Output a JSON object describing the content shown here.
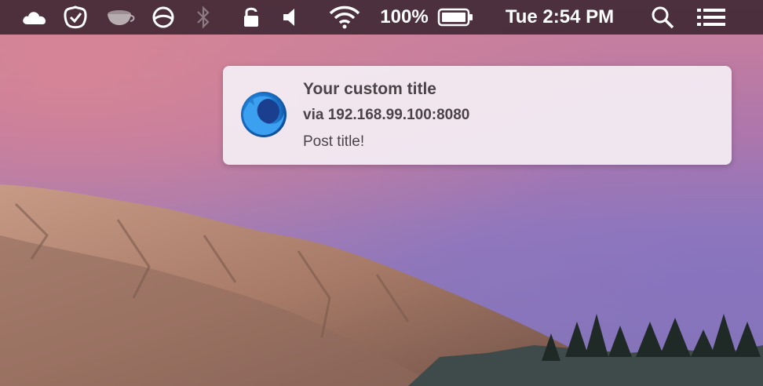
{
  "menubar": {
    "battery_percent": "100%",
    "clock": "Tue 2:54 PM",
    "icons": [
      "cloud-icon",
      "todo-check-icon",
      "teacup-icon",
      "circle-slash-icon",
      "bluetooth-icon",
      "lock-icon",
      "volume-icon",
      "wifi-icon",
      "battery-icon",
      "search-icon",
      "menu-list-icon"
    ]
  },
  "notification": {
    "title": "Your custom title",
    "subtitle": "via 192.168.99.100:8080",
    "body": "Post title!",
    "app_icon": "firefox-developer-icon"
  },
  "colors": {
    "menubar": "#3a2430",
    "notification_bg": "#f3ecf2",
    "notification_text": "#4a4448"
  }
}
